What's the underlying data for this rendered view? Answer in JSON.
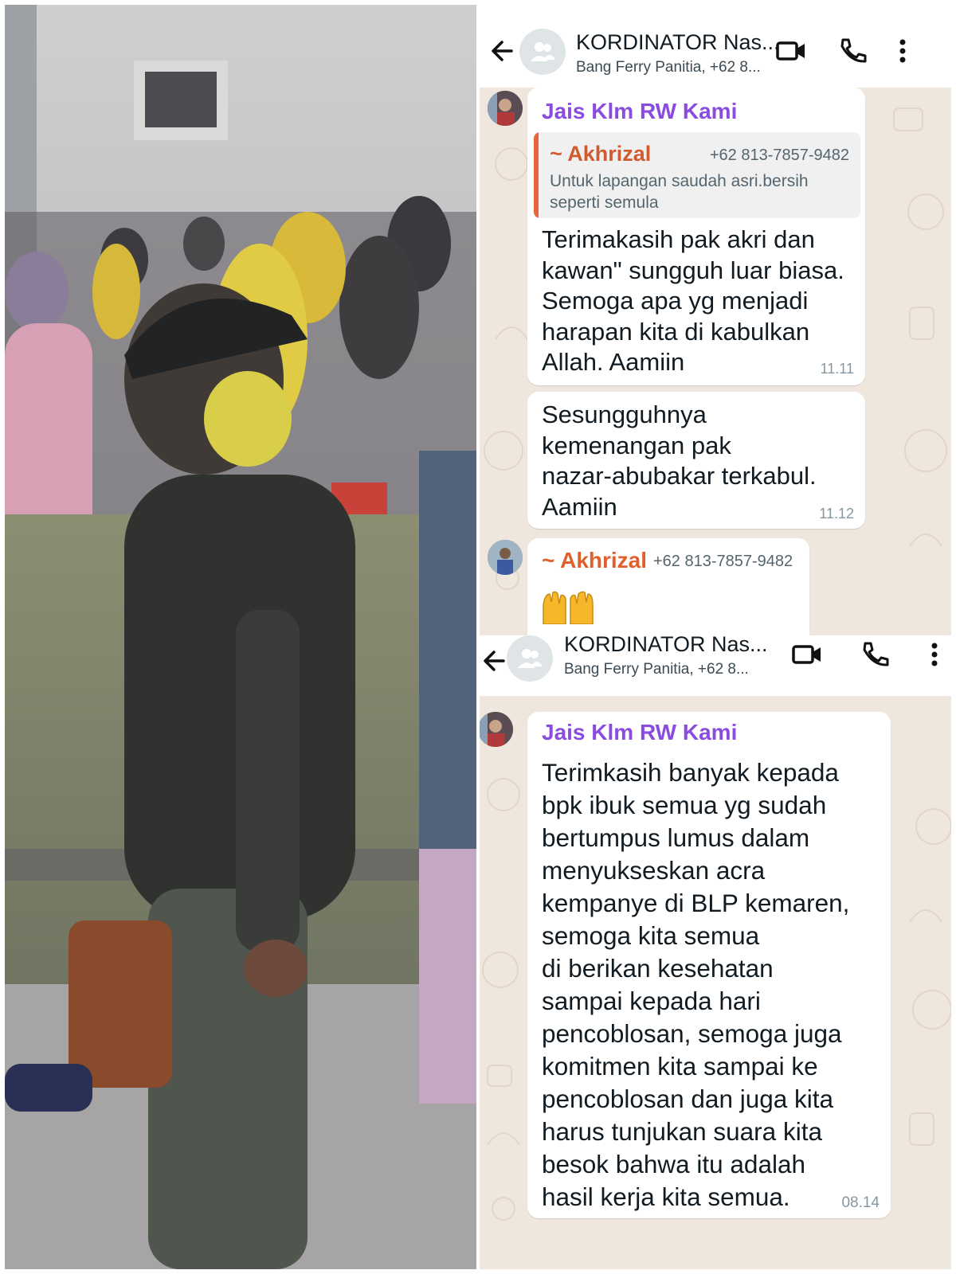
{
  "photo": {
    "description_icon": "photo-image"
  },
  "screenshot1": {
    "header": {
      "title": "KORDINATOR Nas...",
      "subtitle": "Bang Ferry Panitia, +62 8..."
    },
    "messages": [
      {
        "sender": "Jais Klm RW Kami",
        "quote": {
          "name": "~ Akhrizal",
          "phone": "+62 813-7857-9482",
          "text": "Untuk lapangan saudah asri.bersih\nseperti semula"
        },
        "text": "Terimakasih pak akri dan\nkawan\" sungguh luar biasa.\nSemoga apa yg menjadi\nharapan kita di kabulkan\nAllah. Aamiin",
        "time": "11.11"
      },
      {
        "text": "Sesungguhnya\nkemenangan pak\nnazar-abubakar terkabul.\nAamiin",
        "time": "11.12"
      },
      {
        "sender": "~ Akhrizal",
        "phone": "+62 813-7857-9482",
        "emoji": "raising-hands"
      }
    ]
  },
  "screenshot2": {
    "header": {
      "title": "KORDINATOR Nas...",
      "subtitle": "Bang Ferry Panitia, +62 8..."
    },
    "messages": [
      {
        "sender": "Jais Klm RW Kami",
        "text": "Terimkasih banyak kepada\nbpk ibuk semua yg sudah\nbertumpus lumus dalam\nmenyukseskan acra\nkempanye di BLP kemaren,\nsemoga kita semua\ndi berikan kesehatan\nsampai kepada hari\npencoblosan, semoga juga\nkomitmen kita sampai ke\npencoblosan dan juga kita\nharus tunjukan suara kita\nbesok bahwa itu adalah\nhasil kerja kita semua.",
        "time": "08.14"
      }
    ]
  },
  "colors": {
    "sender_purple": "#8a4be0",
    "quote_orange": "#e0602c",
    "wallpaper": "#efe7de"
  }
}
